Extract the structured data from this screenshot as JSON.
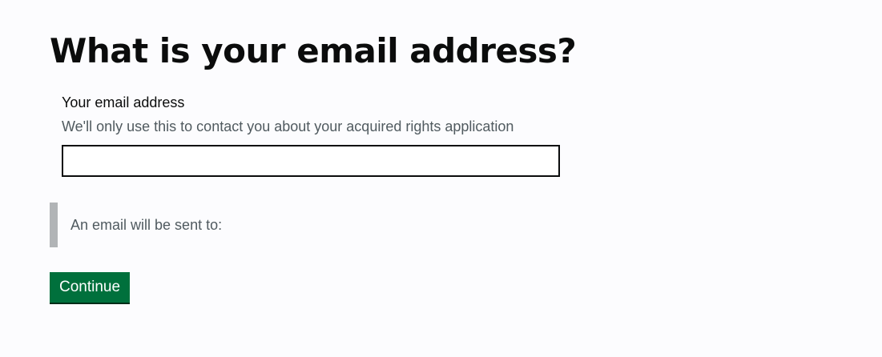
{
  "page": {
    "heading": "What is your email address?"
  },
  "email": {
    "label": "Your email address",
    "hint": "We'll only use this to contact you about your acquired rights application",
    "value": "",
    "placeholder": ""
  },
  "inset": {
    "text": "An email will be sent to:"
  },
  "actions": {
    "continue_label": "Continue"
  },
  "colors": {
    "button": "#00703c",
    "inset_border": "#b1b4b6",
    "hint_text": "#505a5f"
  }
}
